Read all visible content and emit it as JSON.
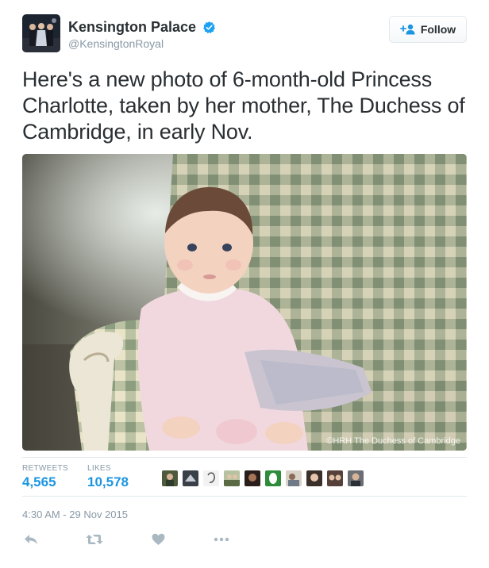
{
  "account": {
    "display_name": "Kensington Palace",
    "handle": "@KensingtonRoyal",
    "verified": true
  },
  "follow_button": {
    "label": "Follow"
  },
  "tweet": {
    "text": "Here's a new photo of 6-month-old Princess Charlotte, taken by her mother, The Duchess of Cambridge, in early Nov.",
    "media_credit": "©HRH The Duchess of Cambridge",
    "timestamp": "4:30 AM - 29 Nov 2015"
  },
  "stats": {
    "retweets_label": "RETWEETS",
    "retweets_value": "4,565",
    "likes_label": "LIKES",
    "likes_value": "10,578"
  },
  "likers_count_shown": 10,
  "actions": [
    "reply-icon",
    "retweet-icon",
    "like-icon",
    "more-icon"
  ],
  "colors": {
    "accent": "#1b95e0",
    "text": "#292f33",
    "muted": "#8899a6",
    "border": "#e1e8ed",
    "action_icon": "#aab8c2"
  }
}
